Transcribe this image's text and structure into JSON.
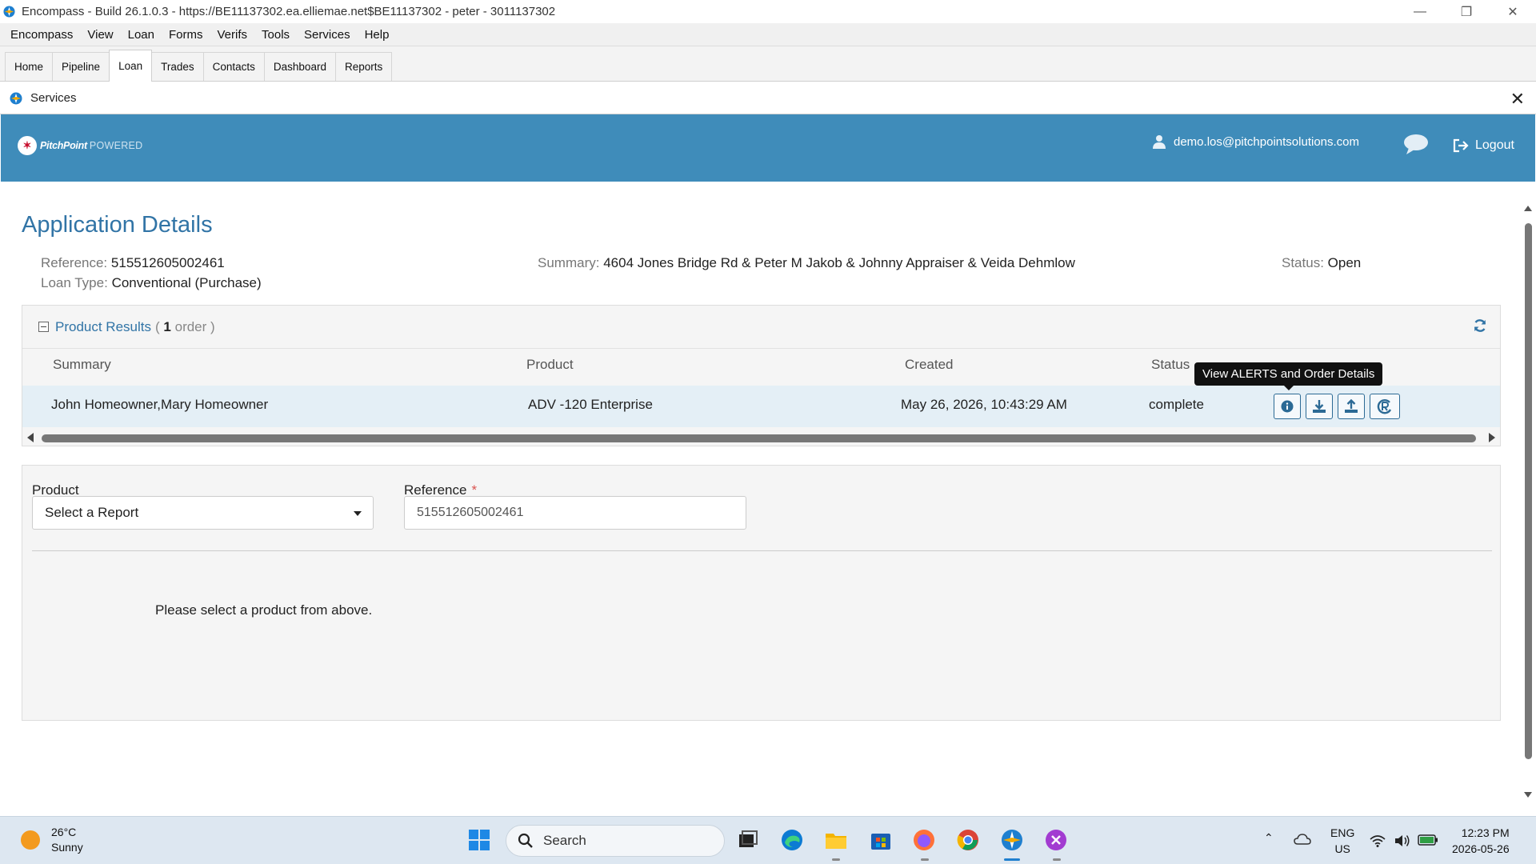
{
  "window": {
    "title": "Encompass - Build 26.1.0.3 - https://BE11137302.ea.elliemae.net$BE11137302 - peter - 3011137302",
    "controls": [
      "minimize",
      "restore",
      "close"
    ]
  },
  "menu": [
    "Encompass",
    "View",
    "Loan",
    "Forms",
    "Verifs",
    "Tools",
    "Services",
    "Help"
  ],
  "tabs": [
    {
      "label": "Home",
      "active": false
    },
    {
      "label": "Pipeline",
      "active": false
    },
    {
      "label": "Loan",
      "active": true
    },
    {
      "label": "Trades",
      "active": false
    },
    {
      "label": "Contacts",
      "active": false
    },
    {
      "label": "Dashboard",
      "active": false
    },
    {
      "label": "Reports",
      "active": false
    }
  ],
  "services": {
    "title": "Services"
  },
  "header": {
    "brand_name": "PitchPoint",
    "brand_suffix": "POWERED",
    "user_email": "demo.los@pitchpointsolutions.com",
    "logout_label": "Logout",
    "bg_color": "#3f8cba"
  },
  "app": {
    "title": "Application Details",
    "reference_label": "Reference:",
    "reference_value": "515512605002461",
    "loan_type_label": "Loan Type:",
    "loan_type_value": "Conventional (Purchase)",
    "summary_label": "Summary:",
    "summary_value": "4604 Jones Bridge Rd & Peter M Jakob & Johnny Appraiser & Veida Dehmlow",
    "status_label": "Status:",
    "status_value": "Open"
  },
  "results": {
    "title": "Product Results",
    "count_open": "(",
    "count": "1",
    "count_suffix": "order )",
    "columns": [
      "Summary",
      "Product",
      "Created",
      "Status"
    ],
    "rows": [
      {
        "summary": "John Homeowner,Mary Homeowner",
        "product": "ADV -120 Enterprise",
        "created": "May 26, 2026, 10:43:29 AM",
        "status": "complete"
      }
    ],
    "tooltip": "View ALERTS and Order Details",
    "actions": [
      "info-icon",
      "download-icon",
      "upload-icon",
      "reorder-icon"
    ]
  },
  "order_form": {
    "product_label": "Product",
    "product_value": "Select a Report",
    "reference_label": "Reference",
    "required_mark": "*",
    "reference_value": "515512605002461",
    "empty_message": "Please select a product from above."
  },
  "taskbar": {
    "temperature": "26°C",
    "condition": "Sunny",
    "search_placeholder": "Search",
    "lang_top": "ENG",
    "lang_bottom": "US",
    "time": "12:23 PM",
    "date": "2026-05-26"
  }
}
